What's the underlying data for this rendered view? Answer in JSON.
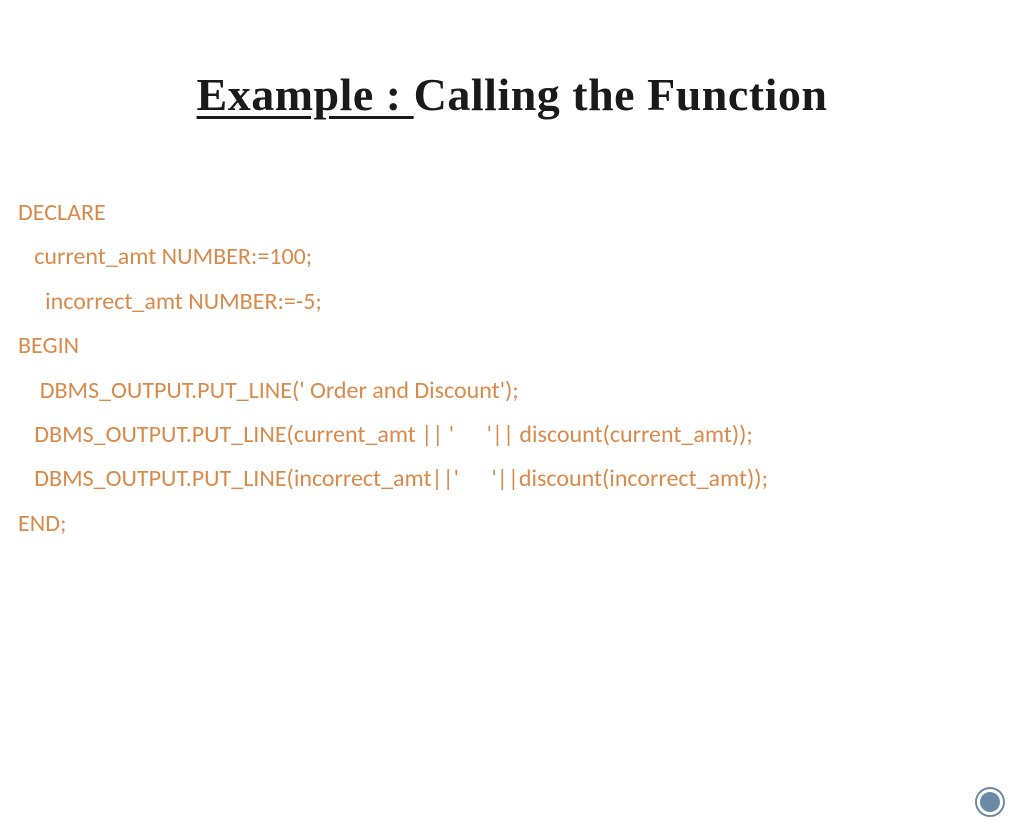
{
  "title": {
    "underlined_part": "Example : ",
    "rest_part": "Calling the Function"
  },
  "code": {
    "line1": "DECLARE",
    "line2": "   current_amt NUMBER:=100;",
    "line3": "     incorrect_amt NUMBER:=-5;",
    "line4": "BEGIN",
    "line5": "    DBMS_OUTPUT.PUT_LINE(' Order and Discount');",
    "line6": "   DBMS_OUTPUT.PUT_LINE(current_amt || '      '|| discount(current_amt));",
    "line7": "   DBMS_OUTPUT.PUT_LINE(incorrect_amt||'      '||discount(incorrect_amt));",
    "line8": "END;"
  }
}
